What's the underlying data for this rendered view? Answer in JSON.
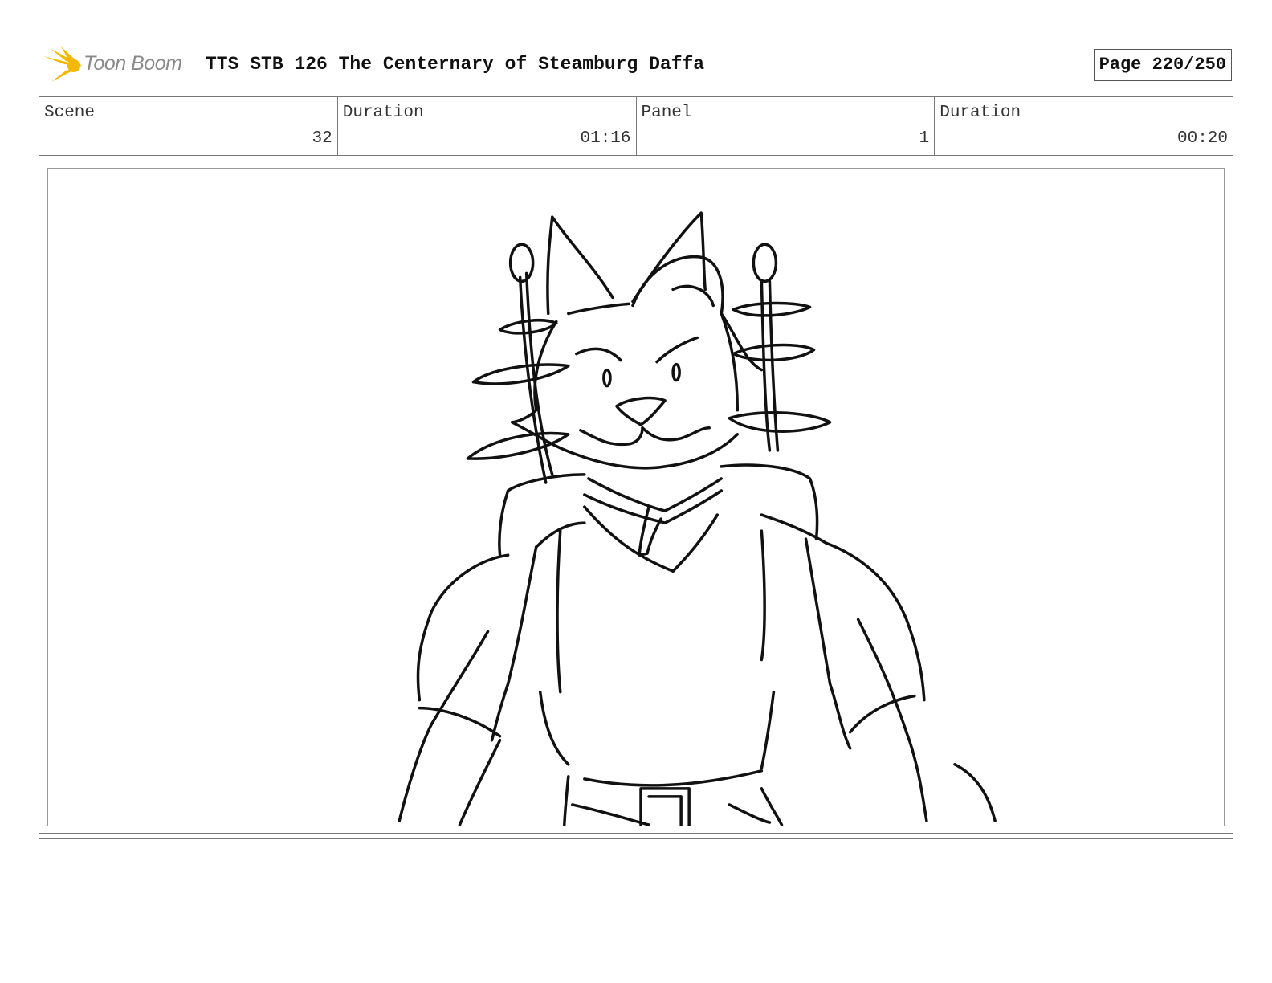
{
  "header": {
    "logo_text": "Toon Boom",
    "title": "TTS STB 126 The Centernary of Steamburg Daffa",
    "page": "Page 220/250"
  },
  "info": [
    {
      "label": "Scene",
      "value": "32"
    },
    {
      "label": "Duration",
      "value": "01:16"
    },
    {
      "label": "Panel",
      "value": "1"
    },
    {
      "label": "Duration",
      "value": "00:20"
    }
  ],
  "panel": {
    "drawing_icon": "sketch-drawing"
  },
  "notes": {
    "text": ""
  },
  "colors": {
    "logo_burst": "#f5b800",
    "logo_text": "#8a8a8a",
    "border": "#777777"
  }
}
